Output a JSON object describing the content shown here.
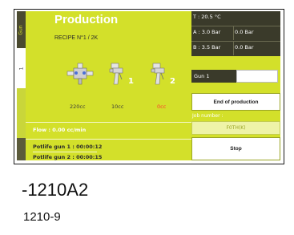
{
  "screen": {
    "title": "Production",
    "recipe": "RECIPE N°1 / 2K",
    "tabs": [
      "Gun",
      "1",
      "",
      ""
    ],
    "status": {
      "temperature": "T : 20.5 °C",
      "a_label": "A : 3.0 Bar",
      "a_value": "0.0 Bar",
      "b_label": "B : 3.5 Bar",
      "b_value": "0.0 Bar"
    },
    "guns": [
      "1",
      "2"
    ],
    "volumes": [
      "220cc",
      "10cc",
      "0cc"
    ],
    "flow": "Flow : 0.00 cc/min",
    "potlife": [
      "Potlife gun 1 : 00:00:12",
      "Potlife gun 2 : 00:00:15"
    ],
    "gun_selector": "Gun 1",
    "end_button": "End of production",
    "job_label": "Job number :",
    "job_value": "F0TH(K)",
    "stop_button": "Stop"
  },
  "captions": {
    "figure_id": "-1210A2",
    "sub_id": "1210-9"
  },
  "colors": {
    "screen_bg": "#d3e02a",
    "panel_dark": "#3a3a2a",
    "alert_red": "#ff3b2f"
  }
}
